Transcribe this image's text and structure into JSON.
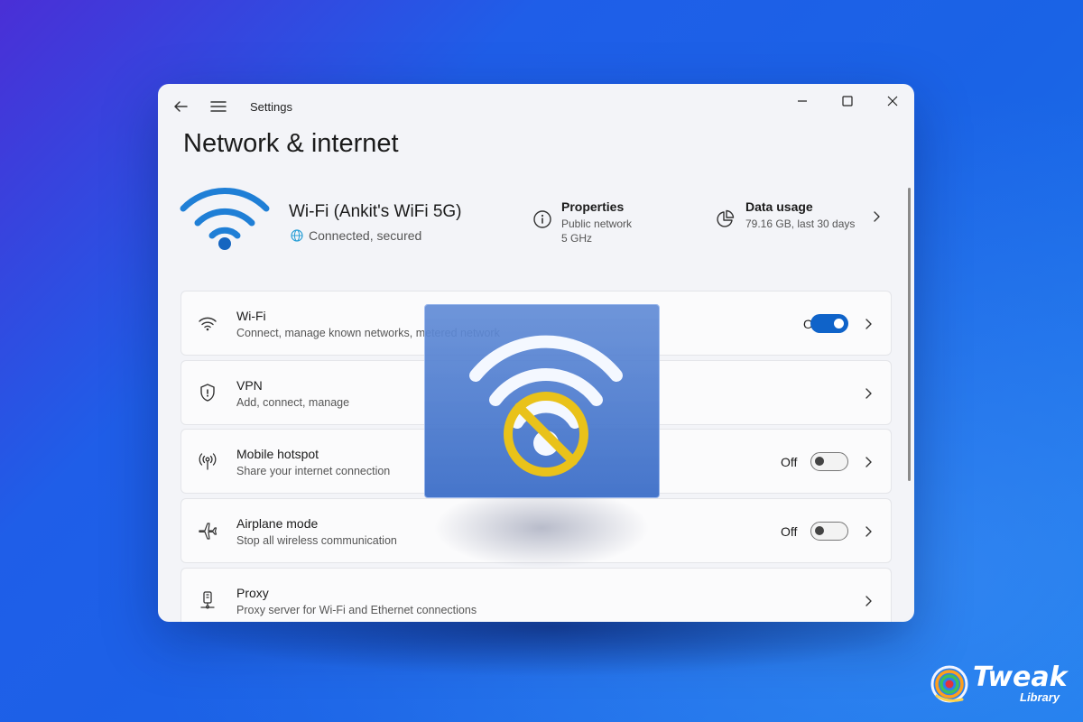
{
  "window": {
    "app_title": "Settings",
    "page_title": "Network & internet"
  },
  "status": {
    "network_name": "Wi-Fi (Ankit's WiFi 5G)",
    "connection_state": "Connected, secured",
    "properties": {
      "title": "Properties",
      "line1": "Public network",
      "line2": "5 GHz"
    },
    "data_usage": {
      "title": "Data usage",
      "detail": "79.16 GB, last 30 days"
    }
  },
  "settings_list": [
    {
      "title": "Wi-Fi",
      "subtitle": "Connect, manage known networks, metered network",
      "state": "On",
      "toggle": true,
      "icon": "wifi-icon"
    },
    {
      "title": "VPN",
      "subtitle": "Add, connect, manage",
      "state": "",
      "toggle": null,
      "icon": "shield-icon"
    },
    {
      "title": "Mobile hotspot",
      "subtitle": "Share your internet connection",
      "state": "Off",
      "toggle": false,
      "icon": "hotspot-icon"
    },
    {
      "title": "Airplane mode",
      "subtitle": "Stop all wireless communication",
      "state": "Off",
      "toggle": false,
      "icon": "airplane-icon"
    },
    {
      "title": "Proxy",
      "subtitle": "Proxy server for Wi-Fi and Ethernet connections",
      "state": "",
      "toggle": null,
      "icon": "proxy-icon"
    }
  ],
  "brand": {
    "name": "Tweak",
    "sub": "Library"
  },
  "colors": {
    "accent": "#0f63c9",
    "wifi_icon": "#1f7fd6",
    "no_signal_ring": "#e9c21a"
  }
}
